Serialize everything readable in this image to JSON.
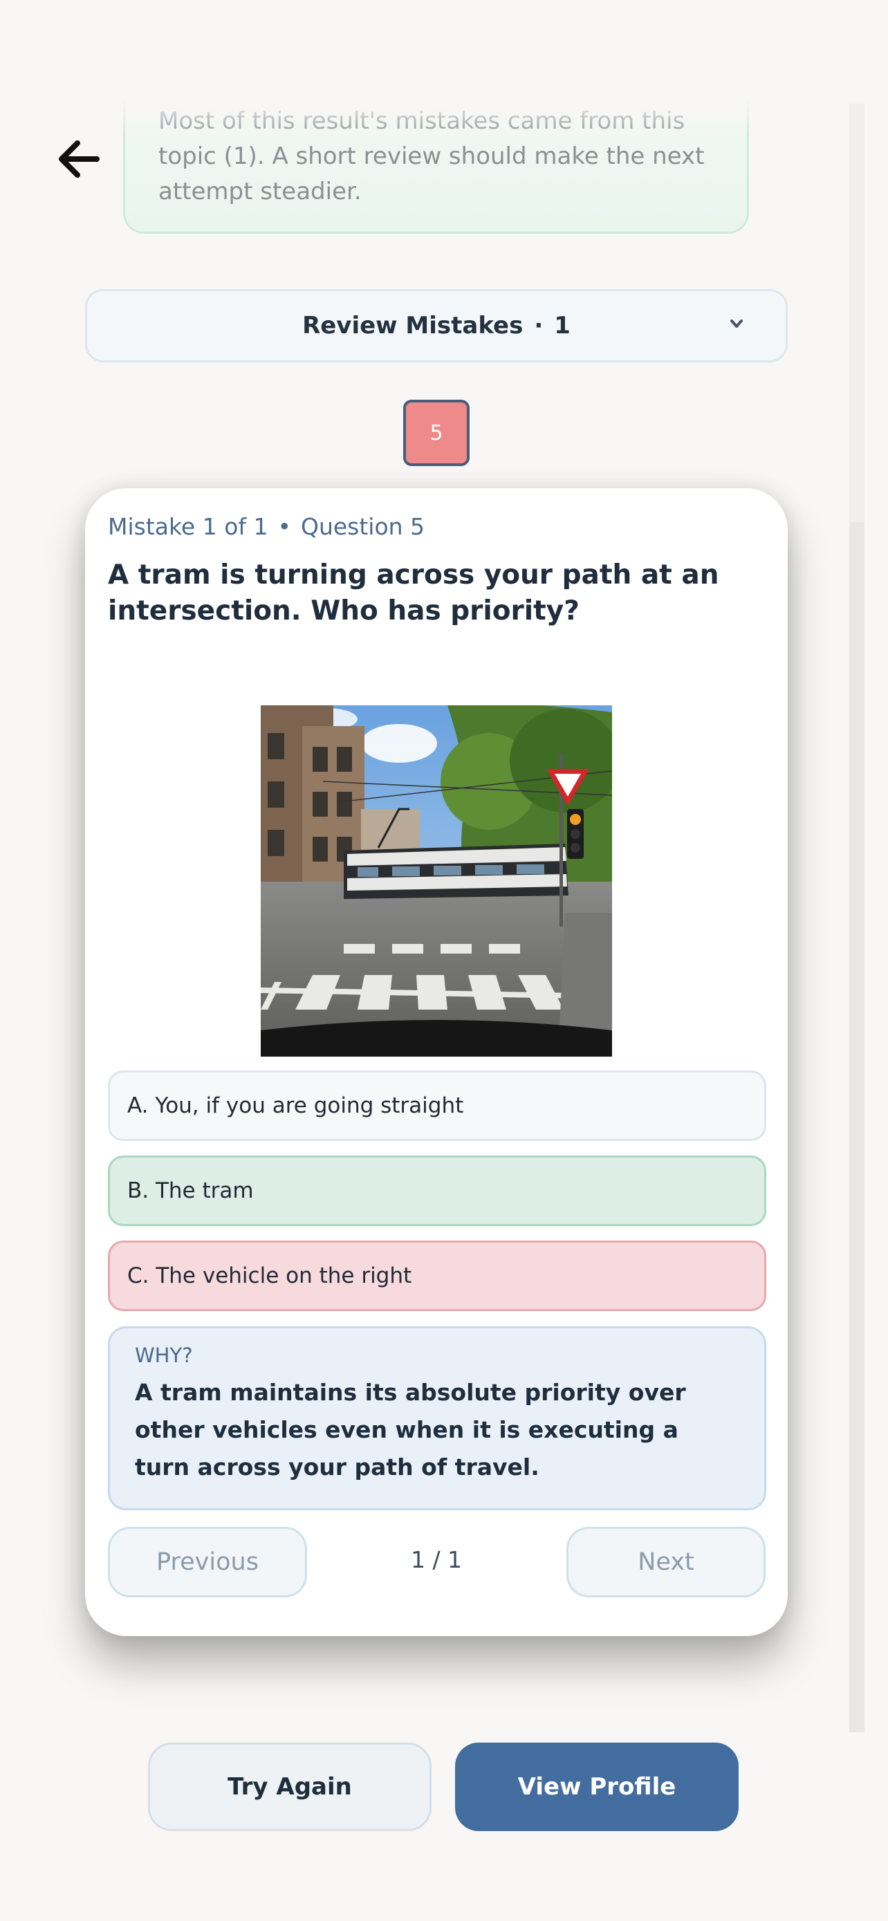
{
  "header": {
    "back_icon": "arrow-left-icon",
    "insight_text": "Most of this result's mistakes came from this topic (1). A short review should make the next attempt steadier."
  },
  "review": {
    "label": "Review Mistakes",
    "separator": "·",
    "count": "1",
    "chevron_icon": "chevron-down-icon"
  },
  "question_chips": [
    "5"
  ],
  "card": {
    "mistake_meta": "Mistake 1 of 1",
    "meta_separator": "•",
    "question_meta": "Question 5",
    "question": "A tram is turning across your path at an intersection. Who has priority?",
    "answers": [
      {
        "text": "A. You, if you are going straight",
        "state": "neutral"
      },
      {
        "text": "B. The tram",
        "state": "correct"
      },
      {
        "text": "C. The vehicle on the right",
        "state": "wrong"
      }
    ],
    "why_label": "WHY?",
    "why_text": "A tram maintains its absolute priority over other vehicles even when it is executing a turn across your path of travel.",
    "prev_label": "Previous",
    "pager": "1 / 1",
    "next_label": "Next"
  },
  "actions": {
    "try_again": "Try Again",
    "view_profile": "View Profile"
  },
  "colors": {
    "accent": "#436d9e",
    "correct": "#dceee6",
    "wrong": "#f6dade",
    "chip": "#ee8a8a"
  }
}
